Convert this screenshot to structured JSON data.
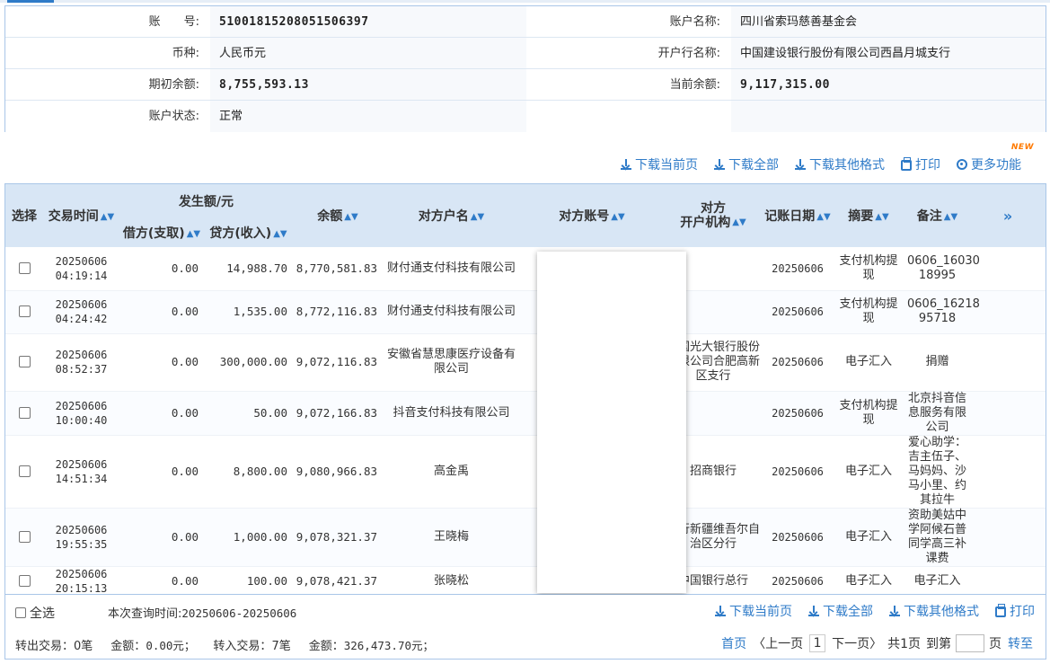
{
  "account": {
    "rows": [
      {
        "l1": "账　　号:",
        "v1": "51001815208051506397",
        "l2": "账户名称:",
        "v2": "四川省索玛慈善基金会"
      },
      {
        "l1": "币种:",
        "v1": "人民币元",
        "l2": "开户行名称:",
        "v2": "中国建设银行股份有限公司西昌月城支行"
      },
      {
        "l1": "期初余额:",
        "v1": "8,755,593.13",
        "l2": "当前余额:",
        "v2": "9,117,315.00"
      },
      {
        "l1": "账户状态:",
        "v1": "正常"
      }
    ]
  },
  "toolbar": {
    "new_badge": "NEW",
    "download_page": "下载当前页",
    "download_all": "下载全部",
    "download_other": "下载其他格式",
    "print": "打印",
    "more": "更多功能"
  },
  "table": {
    "headers": {
      "select": "选择",
      "time": "交易时间",
      "amount_group": "发生额/元",
      "debit": "借方(支取)",
      "credit": "贷方(收入)",
      "balance": "余额",
      "cp_name": "对方户名",
      "cp_account": "对方账号",
      "cp_bank_line1": "对方",
      "cp_bank_line2": "开户机构",
      "post_date": "记账日期",
      "summary": "摘要",
      "remark": "备注",
      "more_cols": "»"
    },
    "rows": [
      {
        "date": "20250606",
        "time": "04:19:14",
        "debit": "0.00",
        "credit": "14,988.70",
        "balance": "8,770,581.83",
        "cp_name": "财付通支付科技有限公司",
        "cp_bank": "",
        "post_date": "20250606",
        "summary": "支付机构提现",
        "remark": "0606_16030 18995"
      },
      {
        "date": "20250606",
        "time": "04:24:42",
        "debit": "0.00",
        "credit": "1,535.00",
        "balance": "8,772,116.83",
        "cp_name": "财付通支付科技有限公司",
        "cp_bank": "",
        "post_date": "20250606",
        "summary": "支付机构提现",
        "remark": "0606_16218 95718"
      },
      {
        "date": "20250606",
        "time": "08:52:37",
        "debit": "0.00",
        "credit": "300,000.00",
        "balance": "9,072,116.83",
        "cp_name": "安徽省慧思康医疗设备有限公司",
        "cp_bank": "中国光大银行股份有限公司合肥高新区支行",
        "post_date": "20250606",
        "summary": "电子汇入",
        "remark": "捐赠"
      },
      {
        "date": "20250606",
        "time": "10:00:40",
        "debit": "0.00",
        "credit": "50.00",
        "balance": "9,072,166.83",
        "cp_name": "抖音支付科技有限公司",
        "cp_bank": "",
        "post_date": "20250606",
        "summary": "支付机构提现",
        "remark": "北京抖音信息服务有限公司"
      },
      {
        "date": "20250606",
        "time": "14:51:34",
        "debit": "0.00",
        "credit": "8,800.00",
        "balance": "9,080,966.83",
        "cp_name": "高金禹",
        "cp_bank": "招商银行",
        "post_date": "20250606",
        "summary": "电子汇入",
        "remark": "爱心助学：吉主伍子、马妈妈、沙马小里、约其拉牛"
      },
      {
        "date": "20250606",
        "time": "19:55:35",
        "debit": "0.00",
        "credit": "1,000.00",
        "balance": "9,078,321.37",
        "cp_name": "王晓梅",
        "cp_bank": "建行新疆维吾尔自治区分行",
        "post_date": "20250606",
        "summary": "电子汇入",
        "remark": "资助美姑中学阿候石普同学高三补课费"
      },
      {
        "date": "20250606",
        "time": "20:15:13",
        "debit": "0.00",
        "credit": "100.00",
        "balance": "9,078,421.37",
        "cp_name": "张晓松",
        "cp_bank": "中国银行总行",
        "post_date": "20250606",
        "summary": "电子汇入",
        "remark": "电子汇入"
      }
    ]
  },
  "footer": {
    "select_all": "全选",
    "query_label": "本次查询时间:",
    "query_range": "20250606-20250606",
    "out_label": "转出交易：",
    "out_count": "0笔",
    "out_amount_label": "金额：",
    "out_amount": "0.00元；",
    "in_label": "转入交易：",
    "in_count": "7笔",
    "in_amount_label": "金额：",
    "in_amount": "326,473.70元；",
    "pager": {
      "first": "首页",
      "prev": "〈上一页",
      "current": "1",
      "next": "下一页〉",
      "total": "共1页",
      "goto": "到第",
      "page_unit": "页",
      "jump": "转至"
    }
  }
}
